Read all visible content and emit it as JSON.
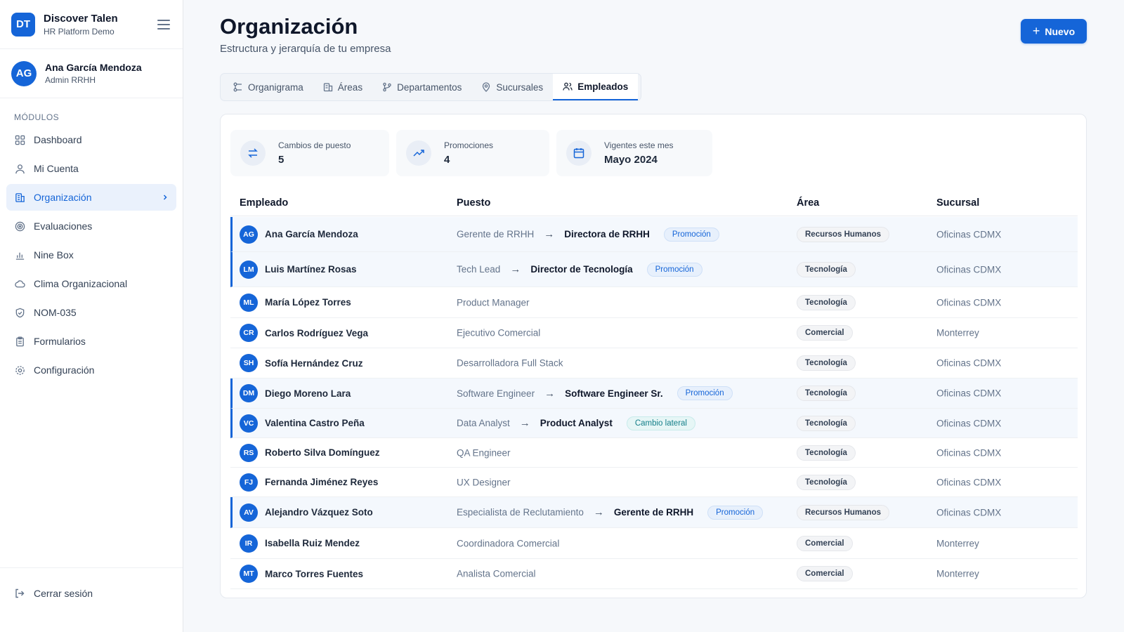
{
  "brand": {
    "logo": "DT",
    "name": "Discover Talen",
    "subtitle": "HR Platform Demo"
  },
  "user": {
    "initials": "AG",
    "name": "Ana García Mendoza",
    "role": "Admin RRHH"
  },
  "sidebar": {
    "section_label": "MÓDULOS",
    "items": [
      {
        "label": "Dashboard",
        "icon": "grid-icon"
      },
      {
        "label": "Mi Cuenta",
        "icon": "user-icon"
      },
      {
        "label": "Organización",
        "icon": "building-icon",
        "active": true
      },
      {
        "label": "Evaluaciones",
        "icon": "target-icon"
      },
      {
        "label": "Nine Box",
        "icon": "bar-chart-icon"
      },
      {
        "label": "Clima Organizacional",
        "icon": "cloud-icon"
      },
      {
        "label": "NOM-035",
        "icon": "shield-icon"
      },
      {
        "label": "Formularios",
        "icon": "clipboard-icon"
      },
      {
        "label": "Configuración",
        "icon": "gear-icon"
      }
    ],
    "logout": "Cerrar sesión"
  },
  "page": {
    "title": "Organización",
    "subtitle": "Estructura y jerarquía de tu empresa",
    "new_button": "Nuevo"
  },
  "tabs": [
    {
      "label": "Organigrama",
      "icon": "org-chart-icon"
    },
    {
      "label": "Áreas",
      "icon": "building-icon"
    },
    {
      "label": "Departamentos",
      "icon": "branch-icon"
    },
    {
      "label": "Sucursales",
      "icon": "map-pin-icon"
    },
    {
      "label": "Empleados",
      "icon": "users-icon",
      "active": true
    }
  ],
  "stats": [
    {
      "label": "Cambios de puesto",
      "value": "5",
      "icon": "swap-icon"
    },
    {
      "label": "Promociones",
      "value": "4",
      "icon": "trending-up-icon"
    },
    {
      "label": "Vigentes este mes",
      "value": "Mayo 2024",
      "icon": "calendar-icon"
    }
  ],
  "table": {
    "headers": {
      "employee": "Empleado",
      "position": "Puesto",
      "area": "Área",
      "branch": "Sucursal"
    },
    "rows": [
      {
        "initials": "AG",
        "name": "Ana García Mendoza",
        "from": "Gerente de RRHH",
        "to": "Directora de RRHH",
        "badge": "Promoción",
        "area": "Recursos Humanos",
        "branch": "Oficinas CDMX"
      },
      {
        "initials": "LM",
        "name": "Luis Martínez Rosas",
        "from": "Tech Lead",
        "to": "Director de Tecnología",
        "badge": "Promoción",
        "area": "Tecnología",
        "branch": "Oficinas CDMX"
      },
      {
        "initials": "ML",
        "name": "María López Torres",
        "from": "Product Manager",
        "to": "",
        "badge": "",
        "area": "Tecnología",
        "branch": "Oficinas CDMX"
      },
      {
        "initials": "CR",
        "name": "Carlos Rodríguez Vega",
        "from": "Ejecutivo Comercial",
        "to": "",
        "badge": "",
        "area": "Comercial",
        "branch": "Monterrey"
      },
      {
        "initials": "SH",
        "name": "Sofía Hernández Cruz",
        "from": "Desarrolladora Full Stack",
        "to": "",
        "badge": "",
        "area": "Tecnología",
        "branch": "Oficinas CDMX"
      },
      {
        "initials": "DM",
        "name": "Diego Moreno Lara",
        "from": "Software Engineer",
        "to": "Software Engineer Sr.",
        "badge": "Promoción",
        "area": "Tecnología",
        "branch": "Oficinas CDMX"
      },
      {
        "initials": "VC",
        "name": "Valentina Castro Peña",
        "from": "Data Analyst",
        "to": "Product Analyst",
        "badge": "Cambio lateral",
        "area": "Tecnología",
        "branch": "Oficinas CDMX"
      },
      {
        "initials": "RS",
        "name": "Roberto Silva Domínguez",
        "from": "QA Engineer",
        "to": "",
        "badge": "",
        "area": "Tecnología",
        "branch": "Oficinas CDMX"
      },
      {
        "initials": "FJ",
        "name": "Fernanda Jiménez Reyes",
        "from": "UX Designer",
        "to": "",
        "badge": "",
        "area": "Tecnología",
        "branch": "Oficinas CDMX"
      },
      {
        "initials": "AV",
        "name": "Alejandro Vázquez Soto",
        "from": "Especialista de Reclutamiento",
        "to": "Gerente de RRHH",
        "badge": "Promoción",
        "area": "Recursos Humanos",
        "branch": "Oficinas CDMX"
      },
      {
        "initials": "IR",
        "name": "Isabella Ruiz Mendez",
        "from": "Coordinadora Comercial",
        "to": "",
        "badge": "",
        "area": "Comercial",
        "branch": "Monterrey"
      },
      {
        "initials": "MT",
        "name": "Marco Torres Fuentes",
        "from": "Analista Comercial",
        "to": "",
        "badge": "",
        "area": "Comercial",
        "branch": "Monterrey"
      }
    ]
  },
  "colors": {
    "primary": "#1565d8",
    "changed_row_bg": "#f4f8fd",
    "lateral_badge": "#16808a"
  }
}
